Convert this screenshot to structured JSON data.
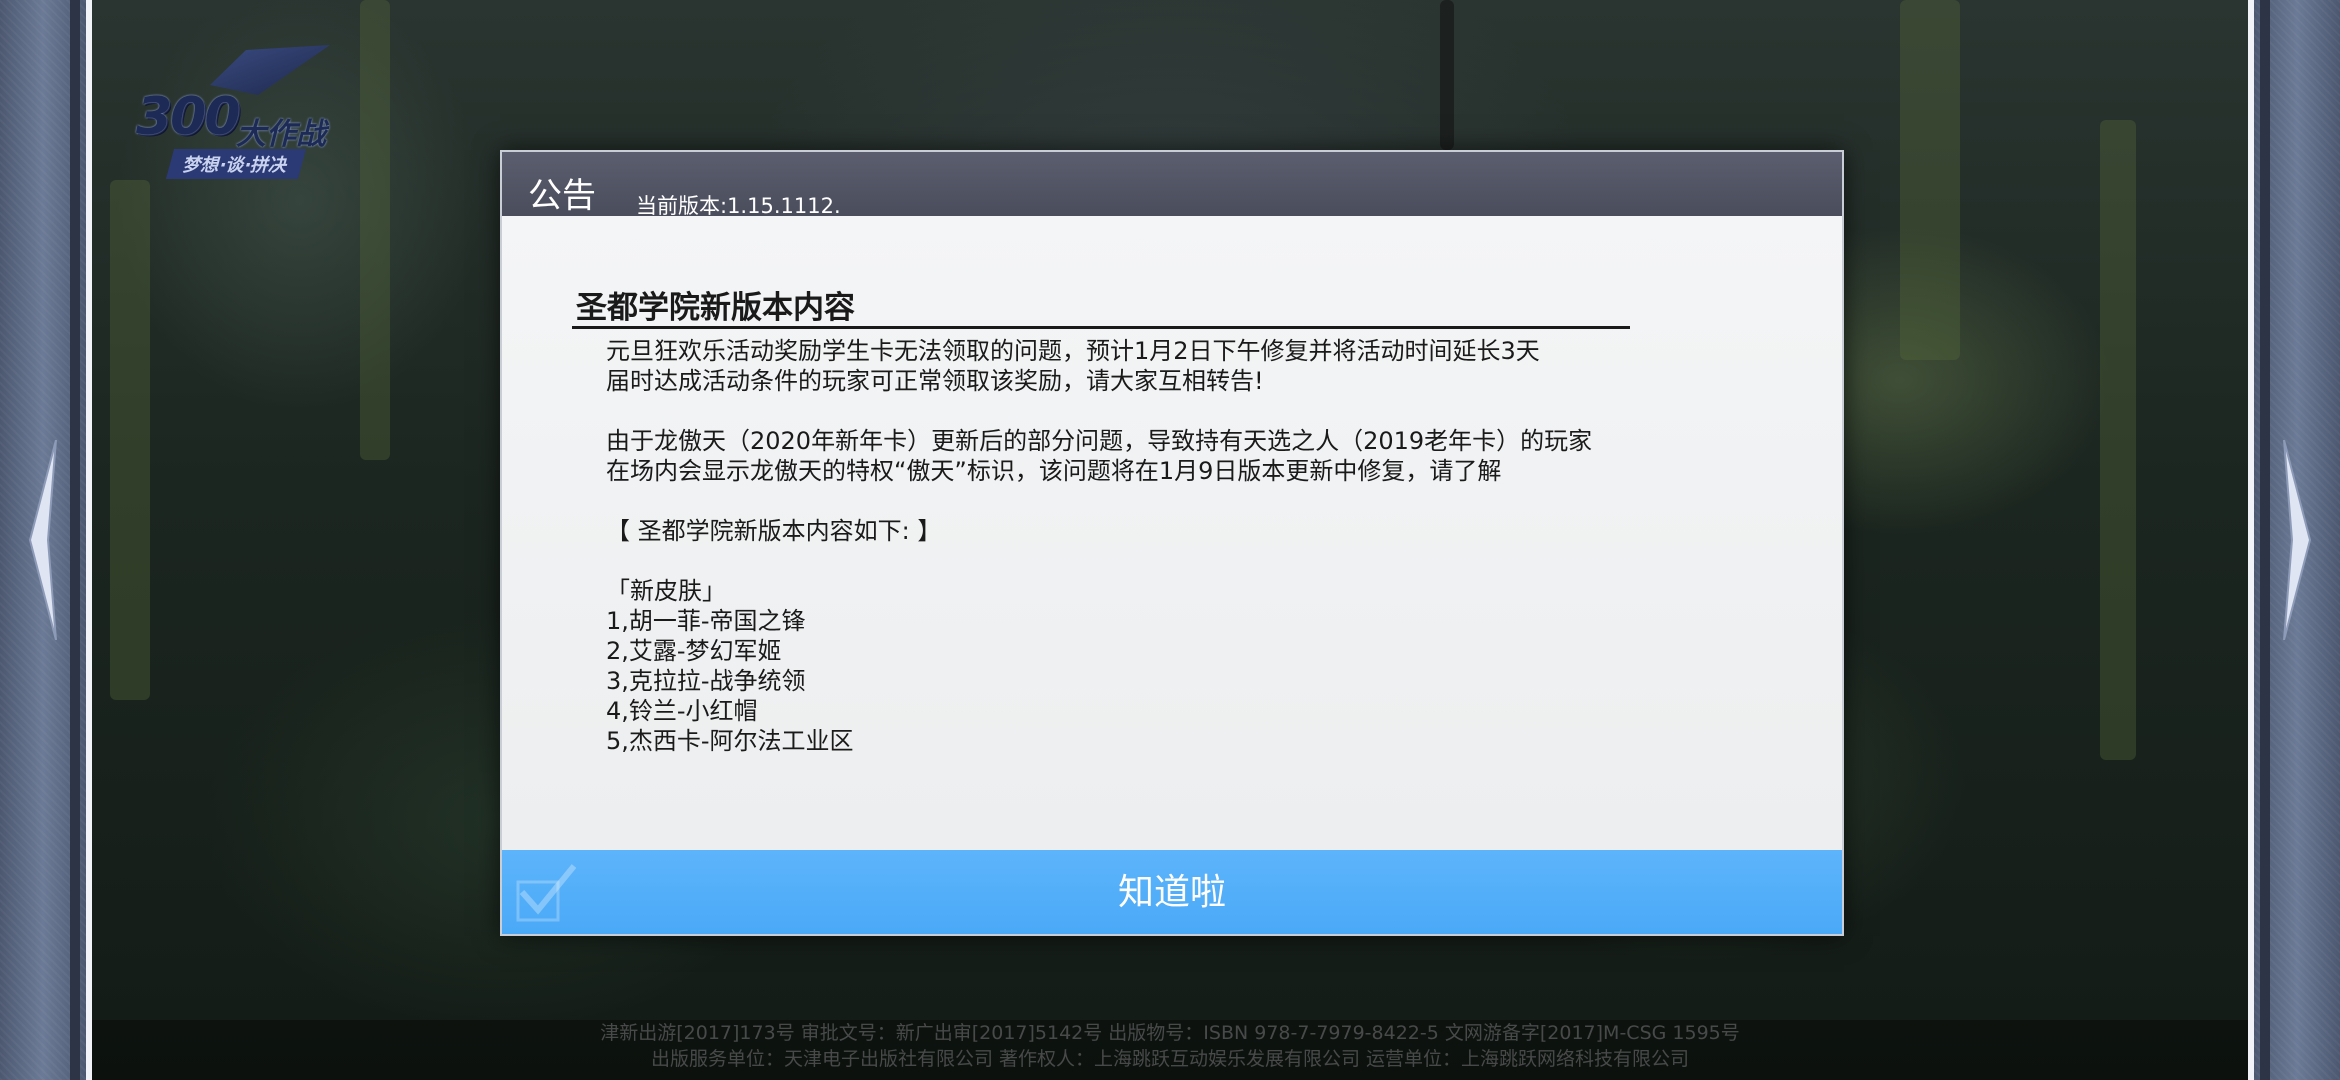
{
  "logo": {
    "number": "300",
    "title": "大作战",
    "subtitle": "梦想·谈·拼决"
  },
  "dialog": {
    "title": "公告",
    "version": "当前版本:1.15.1112.",
    "heading": "圣都学院新版本内容",
    "lines": [
      "元旦狂欢乐活动奖励学生卡无法领取的问题，预计1月2日下午修复并将活动时间延长3天",
      "届时达成活动条件的玩家可正常领取该奖励，请大家互相转告!",
      "",
      "由于龙傲天（2020年新年卡）更新后的部分问题，导致持有天选之人（2019老年卡）的玩家",
      "在场内会显示龙傲天的特权“傲天”标识，该问题将在1月9日版本更新中修复，请了解",
      "",
      "【 圣都学院新版本内容如下: 】",
      "",
      "「新皮肤」",
      "1,胡一菲-帝国之锋",
      "2,艾露-梦幻军姬",
      "3,克拉拉-战争统领",
      "4,铃兰-小红帽",
      "5,杰西卡-阿尔法工业区"
    ],
    "confirm_label": "知道啦"
  },
  "footer": {
    "line1": "津新出游[2017]173号  审批文号：新广出审[2017]5142号  出版物号：ISBN 978-7-7979-8422-5  文网游备字[2017]M-CSG 1595号",
    "line2": "出版服务单位：天津电子出版社有限公司  著作权人：上海跳跃互动娱乐发展有限公司  运营单位：上海跳跃网络科技有限公司"
  },
  "colors": {
    "accent": "#4aa9f7",
    "header": "#4a4d5c",
    "frame": "#5d6b86"
  }
}
